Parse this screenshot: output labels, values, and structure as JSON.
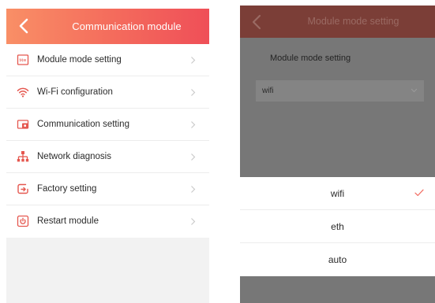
{
  "left": {
    "title": "Communication module",
    "menu": [
      {
        "label": "Module mode setting",
        "icon": "module-mode-icon"
      },
      {
        "label": "Wi-Fi configuration",
        "icon": "wifi-icon"
      },
      {
        "label": "Communication setting",
        "icon": "communication-icon"
      },
      {
        "label": "Network diagnosis",
        "icon": "network-icon"
      },
      {
        "label": "Factory setting",
        "icon": "factory-reset-icon"
      },
      {
        "label": "Restart module",
        "icon": "restart-icon"
      }
    ]
  },
  "right": {
    "title": "Module mode setting",
    "setting_label": "Module mode setting",
    "selected_value": "wifi",
    "options": [
      {
        "label": "wifi",
        "selected": true
      },
      {
        "label": "eth",
        "selected": false
      },
      {
        "label": "auto",
        "selected": false
      }
    ]
  },
  "colors": {
    "accent": "#f46a5c",
    "icon": "#e5574f",
    "check": "#f26c61"
  }
}
